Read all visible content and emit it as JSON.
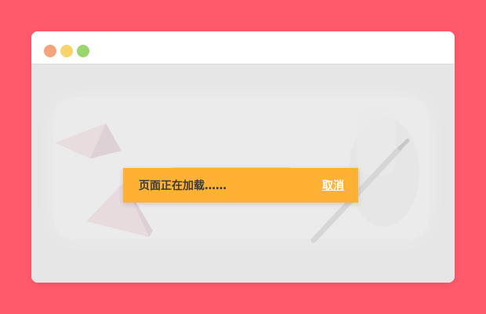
{
  "window": {
    "controls": [
      {
        "name": "close",
        "color": "#f6a27d"
      },
      {
        "name": "minimize",
        "color": "#f8d46a"
      },
      {
        "name": "maximize",
        "color": "#9bd56e"
      }
    ]
  },
  "loading": {
    "message": "页面正在加载……",
    "cancel_label": "取消"
  },
  "colors": {
    "page_background": "#ff5a6b",
    "window_background": "#e6e6e6",
    "titlebar_background": "#ffffff",
    "toast_background": "#ffb133",
    "toast_text": "#3a3a3a",
    "cancel_text": "#ffffff"
  }
}
